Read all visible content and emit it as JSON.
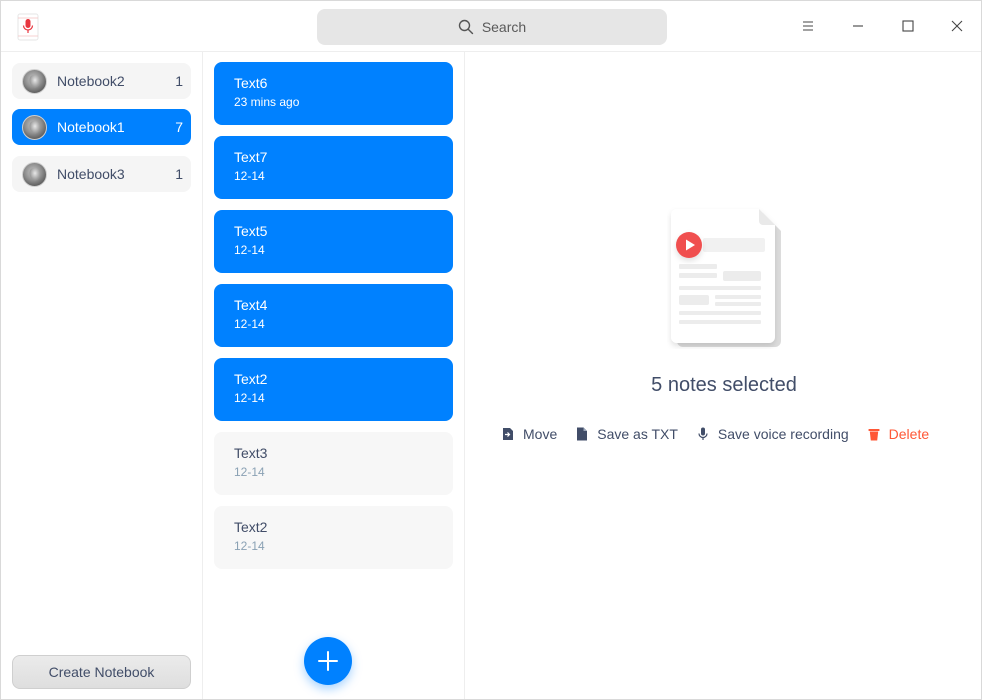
{
  "titlebar": {
    "search_placeholder": "Search",
    "icons": {
      "app": "voice-notes-app-icon",
      "search": "search-icon",
      "menu": "hamburger-menu-icon",
      "minimize": "minimize-icon",
      "maximize": "maximize-icon",
      "close": "close-icon"
    }
  },
  "sidebar": {
    "notebooks": [
      {
        "name": "Notebook2",
        "count": "1",
        "selected": false
      },
      {
        "name": "Notebook1",
        "count": "7",
        "selected": true
      },
      {
        "name": "Notebook3",
        "count": "1",
        "selected": false
      }
    ],
    "create_label": "Create Notebook"
  },
  "notes": {
    "items": [
      {
        "title": "Text6",
        "time": "23 mins ago",
        "selected": true
      },
      {
        "title": "Text7",
        "time": "12-14",
        "selected": true
      },
      {
        "title": "Text5",
        "time": "12-14",
        "selected": true
      },
      {
        "title": "Text4",
        "time": "12-14",
        "selected": true
      },
      {
        "title": "Text2",
        "time": "12-14",
        "selected": true
      },
      {
        "title": "Text3",
        "time": "12-14",
        "selected": false
      },
      {
        "title": "Text2",
        "time": "12-14",
        "selected": false
      }
    ],
    "add_icon": "plus-icon"
  },
  "detail": {
    "selection_text": "5 notes selected",
    "actions": [
      {
        "label": "Move",
        "icon": "move-icon"
      },
      {
        "label": "Save as TXT",
        "icon": "file-icon"
      },
      {
        "label": "Save voice recording",
        "icon": "microphone-icon"
      },
      {
        "label": "Delete",
        "icon": "trash-icon"
      }
    ]
  },
  "colors": {
    "accent": "#0081ff",
    "danger": "#ff5736",
    "text": "#414d68",
    "muted": "#8aa1b4"
  }
}
